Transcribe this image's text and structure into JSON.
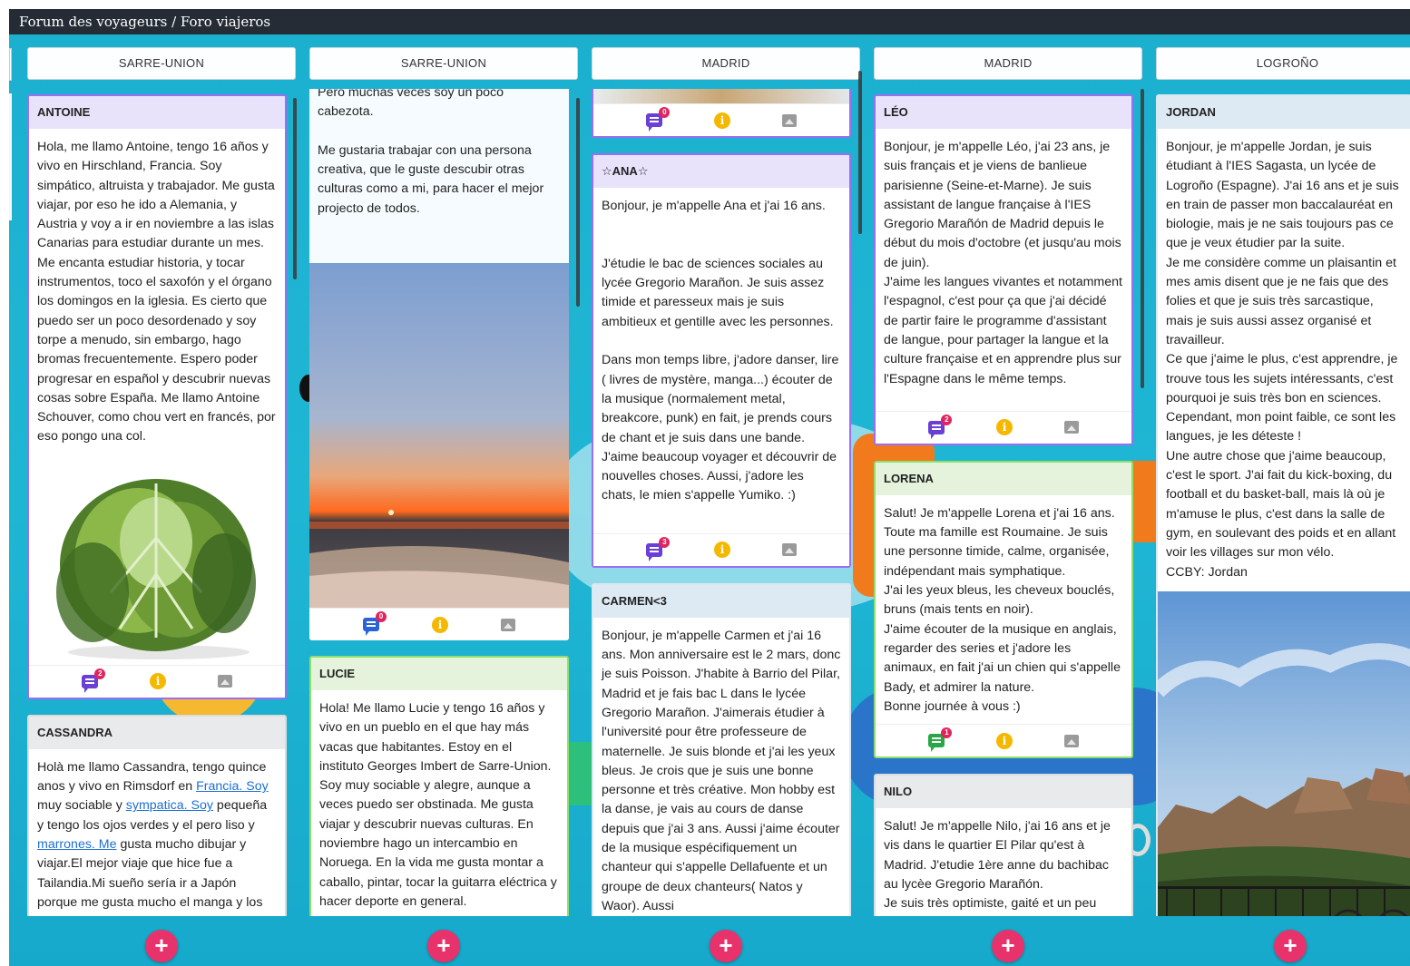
{
  "app": {
    "title": "Forum des voyageurs / Foro viajeros"
  },
  "colors": {
    "accent_add": "#e8326b",
    "topbar": "#252c36",
    "board_bg": "#1cb0cf"
  },
  "columns": [
    {
      "title": "SARRE-UNION",
      "cards": [
        {
          "author": "ANTOINE",
          "body": "Hola, me llamo Antoine, tengo 16 años y vivo en Hirschland, Francia. Soy simpático, altruista y trabajador. Me gusta viajar, por eso he ido a Alemania, y Austria y voy a ir en noviembre a las islas Canarias para estudiar durante un mes. Me encanta estudiar historia, y tocar instrumentos, toco el saxofón y el órgano los domingos en la iglesia. Es cierto que puedo ser un poco desordenado y soy torpe a menudo, sin embargo, hago bromas frecuentemente. Espero poder progresar en español y descubrir nuevas cosas sobre España. Me llamo Antoine Schouver, como chou vert en francés, por eso pongo una col.",
          "comments": "2",
          "icons": {
            "comment": "comment-icon",
            "info": "info-icon",
            "image": "image-icon"
          }
        },
        {
          "author": "CASSANDRA",
          "body_parts": {
            "p1": "Holà me llamo Cassandra, tengo quince anos y vivo en Rimsdorf en ",
            "link1": "Francia. Soy",
            "p2": " muy sociable y ",
            "link2": "sympatica. Soy",
            "p3": " pequeña y tengo los ojos verdes y el pero liso y ",
            "link3": "marrones. Me",
            "p4": " gusta mucho dibujar y viajar.El mejor viaje que hice fue a Tailandia.Mi sueño sería ir a Japón porque me gusta mucho el manga y los sushis y el historia de Japón.Mis mangas"
          }
        }
      ]
    },
    {
      "title": "SARRE-UNION",
      "cards": [
        {
          "author": "",
          "body": "Pero muchas veces soy un poco cabezota.\n\nMe gustaria trabajar con una persona creativa, que le guste descubir otras culturas como  a mi, para hacer el mejor projecto de todos.",
          "comments": "0"
        },
        {
          "author": "LUCIE",
          "body": "Hola! Me llamo Lucie y tengo 16 años y vivo en un pueblo en el que hay más vacas que habitantes. Estoy en el instituto Georges Imbert de Sarre-Union. Soy muy sociable y alegre, aunque a veces puedo ser obstinada. Me gusta viajar y descubrir nuevas culturas. En noviembre hago un intercambio en Noruega. En la vida me gusta montar a caballo, pintar, tocar la guitarra eléctrica y hacer deporte en general."
        }
      ]
    },
    {
      "title": "MADRID",
      "cards": [
        {
          "author": "",
          "comments": "0"
        },
        {
          "author": "☆ANA☆",
          "body": "Bonjour, je m'appelle Ana et j'ai 16 ans.\n\n\nJ'étudie le bac de sciences sociales au lycée Gregorio Marañon. Je suis assez timide et paresseux mais je suis ambitieux et gentille avec les personnes.\n\nDans mon temps libre, j'adore danser, lire ( livres de mystère, manga...) écouter de la musique   (normalement metal, breakcore, punk) en fait, je prends cours de chant et je suis dans une bande. J'aime beaucoup voyager et découvrir de nouvelles choses. Aussi, j'adore les chats, le mien s'appelle Yumiko. :)",
          "comments": "3"
        },
        {
          "author": "CARMEN<3",
          "body": "Bonjour, je m'appelle Carmen et j'ai 16 ans. Mon anniversaire est le 2 mars, donc je suis Poisson. J'habite à Barrio del Pilar, Madrid et je fais bac L dans le lycée Gregorio Marañon. J'aimerais étudier à l'université pour être professeure de maternelle. Je suis blonde et j'ai les yeux bleus. Je crois que je suis une bonne personne et très créative. Mon hobby est la danse, je vais au cours de danse depuis que j'ai 3 ans. Aussi j'aime écouter de la musique espécifiquement un chanteur qui s'appelle Dellafuente et un groupe de deux chanteurs( Natos y Waor). Aussi"
        }
      ]
    },
    {
      "title": "MADRID",
      "cards": [
        {
          "author": "LÉO",
          "body": "Bonjour, je m'appelle Léo, j'ai 23 ans, je suis français et je viens de banlieue parisienne (Seine-et-Marne). Je suis assistant de langue française à l'IES Gregorio Marañón de Madrid depuis le début du mois d'octobre (et jusqu'au mois de juin).\nJ'aime les langues vivantes et notamment l'espagnol, c'est pour ça que j'ai décidé de partir faire le programme d'assistant de langue, pour partager la langue et la culture française et en apprendre plus sur l'Espagne dans le même temps.",
          "comments": "2"
        },
        {
          "author": "LORENA",
          "body": "Salut! Je m'appelle Lorena et j'ai 16 ans. Toute ma famille est Roumaine. Je suis une personne timide, calme, organisée, indépendant mais symphatique.\nJ'ai les yeux bleus, les cheveux bouclés, bruns (mais tents en noir).\nJ'aime écouter de la musique en anglais, regarder des series et j'adore les animaux, en fait j'ai un chien qui s'appelle Bady, et admirer la nature.\nBonne journée à vous :)",
          "comments": "1"
        },
        {
          "author": "NILO",
          "body": "Salut! Je m'appelle Nilo, j'ai 16 ans et je vis dans le quartier El Pilar qu'est à Madrid. J'etudie 1ère anne du bachibac au lycèe Gregorio Marañón.\nJe suis très optimiste, gaité et un peu"
        }
      ]
    },
    {
      "title": "LOGROÑO",
      "cards": [
        {
          "author": "JORDAN",
          "body": "Bonjour, je m'appelle Jordan, je suis étudiant à l'IES Sagasta, un lycée de Logroño (Espagne). J'ai 16 ans et je suis en train de passer mon baccalauréat en biologie, mais je ne sais toujours pas ce que je veux étudier par la suite.\nJe me considère comme un plaisantin et mes amis disent que je ne fais que des folies et que je suis très sarcastique, mais je suis aussi assez organisé et travailleur.\nCe que j'aime le plus, c'est apprendre, je trouve tous les sujets intéressants, c'est pourquoi je suis très bon en sciences. Cependant, mon point faible, ce sont les langues, je les déteste !\nUne autre chose que j'aime beaucoup, c'est le sport. J'ai fait du kick-boxing, du football et du basket-ball, mais là où je m'amuse le plus, c'est dans la salle de gym, en soulevant des poids et en allant voir les villages sur mon vélo.\nCCBY: Jordan"
        }
      ]
    }
  ],
  "add_label": "+"
}
